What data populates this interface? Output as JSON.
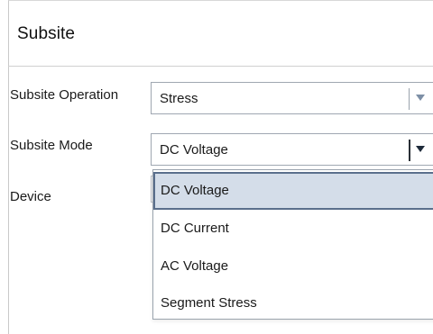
{
  "panel": {
    "title": "Subsite"
  },
  "fields": {
    "operation": {
      "label": "Subsite Operation",
      "value": "Stress"
    },
    "mode": {
      "label": "Subsite Mode",
      "value": "DC Voltage"
    },
    "device": {
      "label": "Device"
    }
  },
  "dropdown": {
    "options": [
      {
        "label": "DC Voltage",
        "selected": true
      },
      {
        "label": "DC Current",
        "selected": false
      },
      {
        "label": "AC Voltage",
        "selected": false
      },
      {
        "label": "Segment Stress",
        "selected": false
      }
    ]
  },
  "colors": {
    "selected_bg": "#d4dde9",
    "selected_border": "#5a6f8c",
    "caret_closed": "#7d8fa6",
    "caret_open": "#1e2a3a"
  },
  "icons": {
    "operation_caret": "chevron-down-icon",
    "mode_caret": "chevron-down-icon"
  }
}
